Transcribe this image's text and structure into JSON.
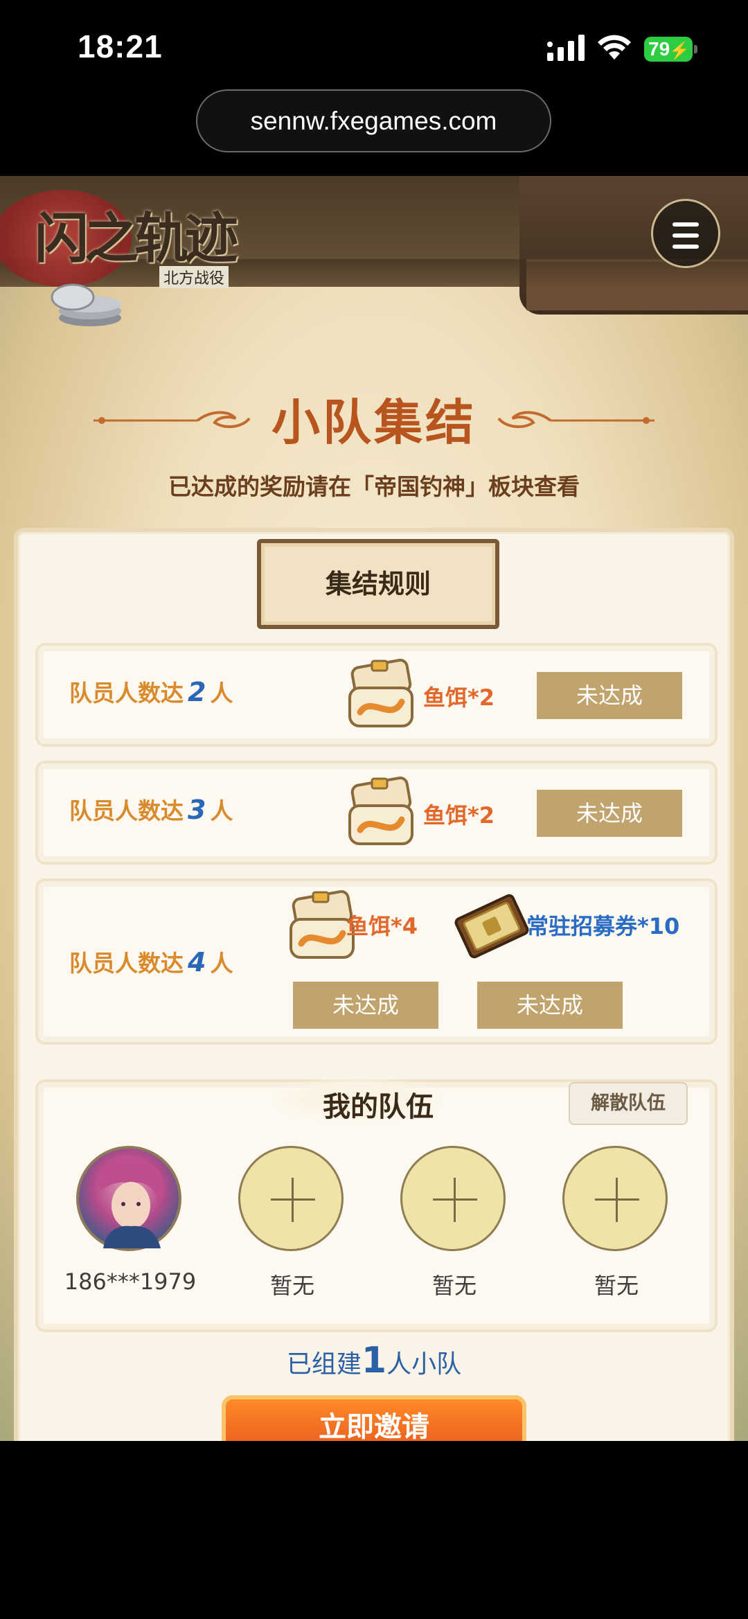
{
  "status_bar": {
    "time": "18:21",
    "battery": "79"
  },
  "browser": {
    "url": "sennw.fxegames.com"
  },
  "header": {
    "logo_text": "闪之轨迹",
    "logo_sub": "北方战役"
  },
  "page": {
    "title": "小队集结",
    "subtitle": "已达成的奖励请在「帝国钓神」板块查看",
    "rules_title": "集结规则"
  },
  "rules": [
    {
      "prefix": "队员人数达",
      "count": "2",
      "suffix": "人",
      "rewards": [
        {
          "text": "鱼饵*2",
          "status": "未达成"
        }
      ]
    },
    {
      "prefix": "队员人数达",
      "count": "3",
      "suffix": "人",
      "rewards": [
        {
          "text": "鱼饵*2",
          "status": "未达成"
        }
      ]
    },
    {
      "prefix": "队员人数达",
      "count": "4",
      "suffix": "人",
      "rewards": [
        {
          "text": "鱼饵*4",
          "status": "未达成"
        },
        {
          "text": "常驻招募券*10",
          "status": "未达成"
        }
      ]
    }
  ],
  "team": {
    "title": "我的队伍",
    "disband_label": "解散队伍",
    "members": [
      {
        "name": "186***1979",
        "filled": true
      },
      {
        "name": "暂无",
        "filled": false
      },
      {
        "name": "暂无",
        "filled": false
      },
      {
        "name": "暂无",
        "filled": false
      }
    ],
    "summary_prefix": "已组建",
    "summary_count": "1",
    "summary_suffix": "人小队"
  },
  "invite_label": "立即邀请",
  "colors": {
    "accent": "#e2672a",
    "status_button": "#c1a36d",
    "count_blue": "#2b67b8",
    "title": "#b8541e"
  }
}
